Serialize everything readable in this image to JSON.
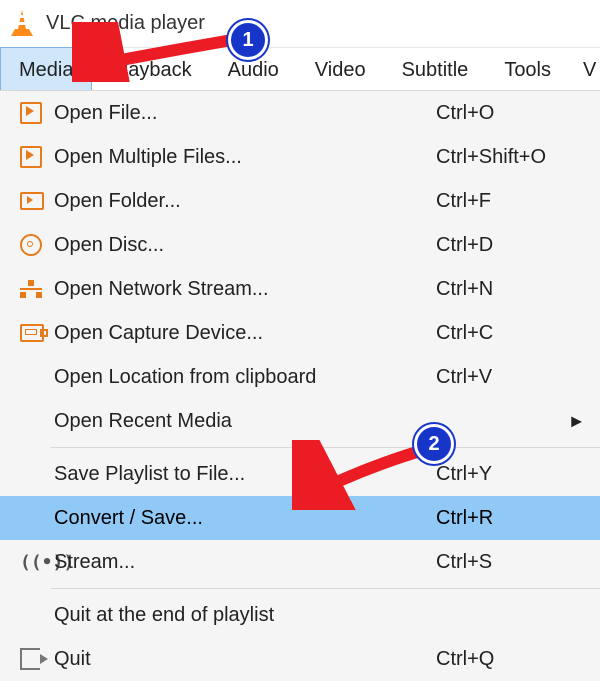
{
  "app": {
    "title": "VLC media player"
  },
  "menubar": {
    "items": [
      "Media",
      "Playback",
      "Audio",
      "Video",
      "Subtitle",
      "Tools",
      "V"
    ],
    "active_index": 0
  },
  "dropdown": {
    "items": [
      {
        "icon": "play",
        "label": "Open File...",
        "shortcut": "Ctrl+O"
      },
      {
        "icon": "play",
        "label": "Open Multiple Files...",
        "shortcut": "Ctrl+Shift+O"
      },
      {
        "icon": "folder",
        "label": "Open Folder...",
        "shortcut": "Ctrl+F"
      },
      {
        "icon": "disc",
        "label": "Open Disc...",
        "shortcut": "Ctrl+D"
      },
      {
        "icon": "net",
        "label": "Open Network Stream...",
        "shortcut": "Ctrl+N"
      },
      {
        "icon": "capture",
        "label": "Open Capture Device...",
        "shortcut": "Ctrl+C"
      },
      {
        "icon": "",
        "label": "Open Location from clipboard",
        "shortcut": "Ctrl+V"
      },
      {
        "icon": "",
        "label": "Open Recent Media",
        "shortcut": "",
        "submenu": true
      },
      {
        "sep": true
      },
      {
        "icon": "",
        "label": "Save Playlist to File...",
        "shortcut": "Ctrl+Y"
      },
      {
        "icon": "",
        "label": "Convert / Save...",
        "shortcut": "Ctrl+R",
        "highlight": true
      },
      {
        "icon": "stream",
        "label": "Stream...",
        "shortcut": "Ctrl+S"
      },
      {
        "sep": true
      },
      {
        "icon": "",
        "label": "Quit at the end of playlist",
        "shortcut": ""
      },
      {
        "icon": "quit",
        "label": "Quit",
        "shortcut": "Ctrl+Q"
      }
    ]
  },
  "annotations": {
    "badge1": "1",
    "badge2": "2"
  }
}
